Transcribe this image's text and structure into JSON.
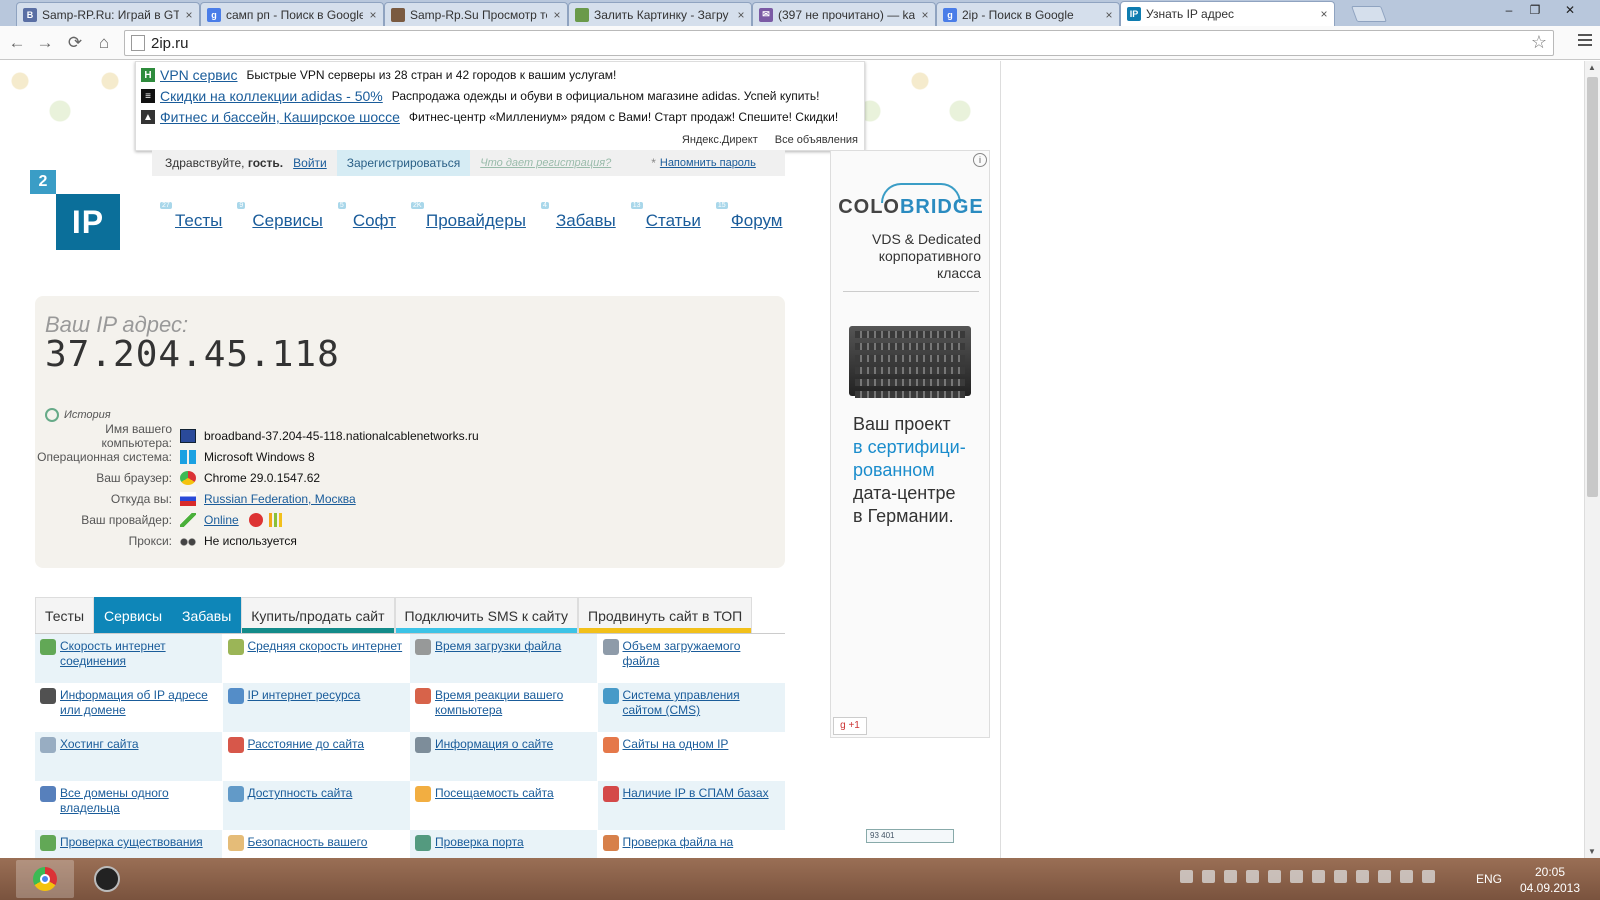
{
  "browser": {
    "tabs": [
      {
        "title": "Samp-RP.Ru: Играй в GTA",
        "icon": "samp-icon",
        "color": "#5a6fa4",
        "glyph": "B"
      },
      {
        "title": "самп рп - Поиск в Google",
        "icon": "google-icon",
        "color": "#4a7de8",
        "glyph": "g"
      },
      {
        "title": "Samp-Rp.Su Просмотр те",
        "icon": "forum-avatar-icon",
        "color": "#7a5a40",
        "glyph": ""
      },
      {
        "title": "Залить Картинку - Загру",
        "icon": "image-upload-icon",
        "color": "#6a9a4a",
        "glyph": ""
      },
      {
        "title": "(397 не прочитано) — ka",
        "icon": "mail-icon",
        "color": "#7b5aa4",
        "glyph": "✉"
      },
      {
        "title": "2ip - Поиск в Google",
        "icon": "google-icon",
        "color": "#4a7de8",
        "glyph": "g"
      },
      {
        "title": "Узнать IP адрес",
        "icon": "2ip-icon",
        "color": "#0e7cb0",
        "glyph": "IP"
      }
    ],
    "close_glyph": "×",
    "window_buttons": {
      "minimize": "‒",
      "maximize": "❐",
      "close": "✕"
    },
    "url": "2ip.ru",
    "nav": {
      "back": "←",
      "forward": "→",
      "reload": "⟳",
      "home": "⌂",
      "star": "☆"
    }
  },
  "direct": {
    "ads": [
      {
        "title": "VPN сервис",
        "text": "Быстрые VPN серверы из 28 стран и 42 городов к вашим услугам!",
        "icon": "vpn-icon",
        "color": "#2e8b3c",
        "glyph": "H"
      },
      {
        "title": "Скидки на коллекции adidas - 50%",
        "text": "Распродажа одежды и обуви в официальном магазине adidas. Успей купить!",
        "icon": "adidas-icon",
        "color": "#111111",
        "glyph": "≡"
      },
      {
        "title": "Фитнес и бассейн, Каширское шоссе",
        "text": "Фитнес-центр «Миллениум» рядом с Вами! Старт продаж! Спешите! Скидки!",
        "icon": "fitness-icon",
        "color": "#333333",
        "glyph": "▲"
      }
    ],
    "footer_left": "Яндекс.Директ",
    "footer_right": "Все объявления"
  },
  "login": {
    "greeting": "Здравствуйте, ",
    "guest": "гость.",
    "login": "Войти",
    "register": "Зарегистрироваться",
    "why": "Что дает регистрация?",
    "star": "*",
    "remind": "Напомнить пароль"
  },
  "logo": {
    "num": "2",
    "text": "IP"
  },
  "nav": [
    {
      "label": "Тесты",
      "count": "27"
    },
    {
      "label": "Сервисы",
      "count": "9"
    },
    {
      "label": "Софт",
      "count": "5"
    },
    {
      "label": "Провайдеры",
      "count": "2K"
    },
    {
      "label": "Забавы",
      "count": "4"
    },
    {
      "label": "Статьи",
      "count": "13"
    },
    {
      "label": "Форум",
      "count": "15"
    }
  ],
  "ip": {
    "label": "Ваш IP адрес:",
    "value": "37.204.45.118",
    "history": "История",
    "rows": [
      {
        "key": "Имя вашего компьютера:",
        "value": "broadband-37.204-45-118.nationalcablenetworks.ru",
        "icon": "computer-icon",
        "link": false
      },
      {
        "key": "Операционная система:",
        "value": "Microsoft Windows 8",
        "icon": "windows-icon",
        "link": false
      },
      {
        "key": "Ваш браузер:",
        "value": "Chrome 29.0.1547.62",
        "icon": "chrome-icon",
        "link": false
      },
      {
        "key": "Откуда вы:",
        "value": "Russian Federation, Москва",
        "icon": "russia-flag-icon",
        "link": true
      },
      {
        "key": "Ваш провайдер:",
        "value": "Online",
        "icon": "provider-icon",
        "link": true
      },
      {
        "key": "Прокси:",
        "value": "Не используется",
        "icon": "proxy-glasses-icon",
        "link": false
      }
    ]
  },
  "section_tabs": [
    {
      "label": "Тесты",
      "active": false,
      "bar": ""
    },
    {
      "label": "Сервисы",
      "active": true,
      "bar": ""
    },
    {
      "label": "Забавы",
      "active": true,
      "bar": ""
    },
    {
      "label": "Купить/продать сайт",
      "active": false,
      "bar": "#138b8a"
    },
    {
      "label": "Подключить SMS к сайту",
      "active": false,
      "bar": "#3cc3e6"
    },
    {
      "label": "Продвинуть сайт в ТОП",
      "active": false,
      "bar": "#f2c01a"
    }
  ],
  "services": [
    {
      "label": "Скорость интернет соединения",
      "icon": "speed-arrow-icon",
      "color": "#4a9a3a"
    },
    {
      "label": "Средняя скорость интернет",
      "icon": "bars-icon",
      "color": "#8aa83a"
    },
    {
      "label": "Время загрузки файла",
      "icon": "clock-icon",
      "color": "#888888"
    },
    {
      "label": "Объем загружаемого файла",
      "icon": "file-size-icon",
      "color": "#7a8a9a"
    },
    {
      "label": "Информация об IP адресе или домене",
      "icon": "ip-info-icon",
      "color": "#333333"
    },
    {
      "label": "IP интернет ресурса",
      "icon": "ip-resource-icon",
      "color": "#3a7ac0"
    },
    {
      "label": "Время реакции вашего компьютера",
      "icon": "reaction-icon",
      "color": "#d0482a"
    },
    {
      "label": "Система управления сайтом (CMS)",
      "icon": "cms-gear-icon",
      "color": "#2a8ac0"
    },
    {
      "label": "Хостинг сайта",
      "icon": "hosting-icon",
      "color": "#8aa0b8"
    },
    {
      "label": "Расстояние до сайта",
      "icon": "map-pin-icon",
      "color": "#d03a2a"
    },
    {
      "label": "Информация о сайте",
      "icon": "document-icon",
      "color": "#6a7a8a"
    },
    {
      "label": "Сайты на одном IP",
      "icon": "shared-ip-icon",
      "color": "#e0602a"
    },
    {
      "label": "Все домены одного владельца",
      "icon": "domains-icon",
      "color": "#3a6ab0"
    },
    {
      "label": "Доступность сайта",
      "icon": "availability-icon",
      "color": "#4a8ac0"
    },
    {
      "label": "Посещаемость сайта",
      "icon": "star-icon",
      "color": "#f0a020"
    },
    {
      "label": "Наличие IP в СПАМ базах",
      "icon": "no-spam-icon",
      "color": "#d02a2a"
    },
    {
      "label": "Проверка существования",
      "icon": "check-icon",
      "color": "#4a9a3a"
    },
    {
      "label": "Безопасность вашего",
      "icon": "security-icon",
      "color": "#e0b060"
    },
    {
      "label": "Проверка порта",
      "icon": "port-icon",
      "color": "#3a8a6a"
    },
    {
      "label": "Проверка файла на",
      "icon": "file-check-icon",
      "color": "#d06a2a"
    }
  ],
  "right_ad": {
    "brand_a": "COLO",
    "brand_b": "BRIDGE",
    "sub": "VDS & Dedicated корпоративного класса",
    "promo_1": "Ваш проект",
    "promo_2": "в сертифици-",
    "promo_3": "рованном",
    "promo_4": "дата-центре",
    "promo_5": "в Германии.",
    "gplus": "g +1",
    "info": "i"
  },
  "counter": "93 401",
  "taskbar": {
    "lang": "ENG",
    "time": "20:05",
    "date": "04.09.2013"
  }
}
